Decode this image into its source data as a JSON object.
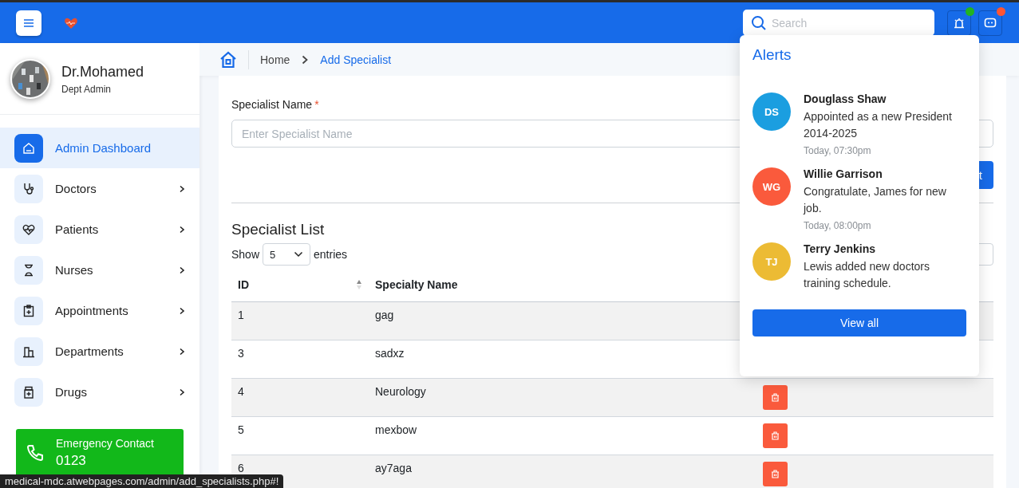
{
  "header": {
    "search": {
      "placeholder": "Search"
    },
    "buttons": [
      {
        "kind": "alerts",
        "color": "#22b322"
      },
      {
        "kind": "chat",
        "color": "#ff5533"
      }
    ]
  },
  "sidebar": {
    "user": {
      "name": "Dr.Mohamed",
      "role": "Dept Admin"
    },
    "items": [
      {
        "label": "Admin Dashboard",
        "selected": true,
        "expandable": false
      },
      {
        "label": "Doctors",
        "selected": false,
        "expandable": true
      },
      {
        "label": "Patients",
        "selected": false,
        "expandable": true
      },
      {
        "label": "Nurses",
        "selected": false,
        "expandable": true
      },
      {
        "label": "Appointments",
        "selected": false,
        "expandable": true
      },
      {
        "label": "Departments",
        "selected": false,
        "expandable": true
      },
      {
        "label": "Drugs",
        "selected": false,
        "expandable": true
      }
    ],
    "emergency": {
      "label": "Emergency Contact",
      "number": "0123"
    }
  },
  "breadcrumb": [
    {
      "label": "Home",
      "current": false
    },
    {
      "label": "Add Specialist",
      "current": true
    }
  ],
  "form": {
    "label": "Specialist Name",
    "required_mark": "*",
    "placeholder": "Enter Specialist Name",
    "submit_button": "t"
  },
  "list": {
    "title": "Specialist List",
    "show_label": "Show",
    "entries_value": "5",
    "entries_label": "entries",
    "columns": [
      {
        "label": "ID",
        "sortable": true
      },
      {
        "label": "Specialty Name"
      }
    ],
    "rows": [
      {
        "id": "1",
        "name": "gag"
      },
      {
        "id": "3",
        "name": "sadxz"
      },
      {
        "id": "4",
        "name": "Neurology",
        "delete_button": true
      },
      {
        "id": "5",
        "name": "mexbow",
        "delete_button": true
      },
      {
        "id": "6",
        "name": "ay7aga",
        "delete_button": true
      }
    ]
  },
  "alerts": {
    "title": "Alerts",
    "items": [
      {
        "initials": "DS",
        "color": "#1b9ee0",
        "name": "Douglass Shaw",
        "message": "Appointed as a new President 2014-2025",
        "time": "Today, 07:30pm"
      },
      {
        "initials": "WG",
        "color": "#fa5a3c",
        "name": "Willie Garrison",
        "message": "Congratulate, James for new job.",
        "time": "Today, 08:00pm"
      },
      {
        "initials": "TJ",
        "color": "#ecbb34",
        "name": "Terry Jenkins",
        "message": "Lewis added new doctors training schedule."
      }
    ],
    "button": "View all"
  },
  "status_bar": {
    "url": "medical-mdc.atwebpages.com/admin/add_specialists.php#!"
  }
}
